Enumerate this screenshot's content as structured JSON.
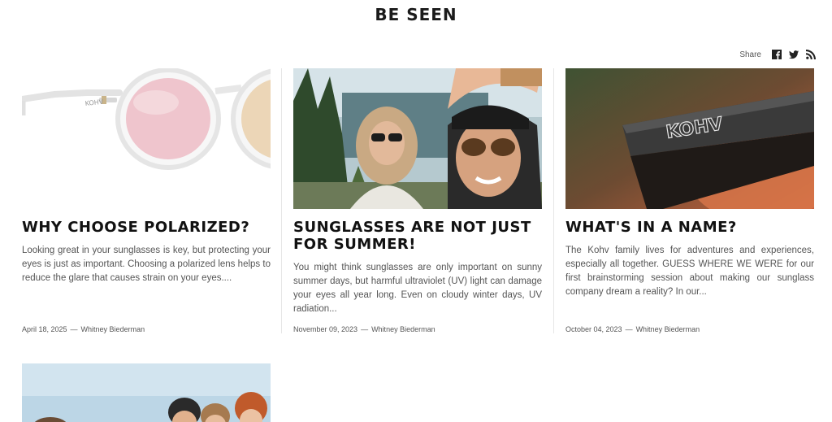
{
  "page": {
    "title": "BE SEEN"
  },
  "share": {
    "label": "Share",
    "icons": [
      "facebook-icon",
      "twitter-icon",
      "rss-icon"
    ]
  },
  "articles": [
    {
      "title": "WHY CHOOSE POLARIZED?",
      "excerpt": "Looking great in your sunglasses is key, but protecting your eyes is just as important. Choosing a polarized lens helps to reduce the glare that causes strain on your eyes....",
      "date": "April 18, 2025",
      "separator": "—",
      "author": "Whitney Biederman",
      "image": "clear-frame-pink-lens-sunglasses"
    },
    {
      "title": "SUNGLASSES ARE NOT JUST FOR SUMMER!",
      "excerpt": "You might think sunglasses are only important on sunny summer days, but harmful ultraviolet (UV) light can damage your eyes all year long. Even on cloudy winter days, UV radiation...",
      "date": "November 09, 2023",
      "separator": "—",
      "author": "Whitney Biederman",
      "image": "family-selfie-lake"
    },
    {
      "title": "WHAT'S IN A NAME?",
      "excerpt": "The Kohv family lives for adventures and experiences, especially all together. GUESS WHERE WE WERE for our first brainstorming session about making our sunglass company dream a reality? In our...",
      "date": "October 04, 2023",
      "separator": "—",
      "author": "Whitney Biederman",
      "image": "kohv-logo-temple-closeup",
      "image_text": "KOHV"
    }
  ],
  "next_row": {
    "image": "group-beach-photo"
  },
  "colors": {
    "text": "#111111",
    "muted": "#555555",
    "divider": "#e6e6e6"
  }
}
